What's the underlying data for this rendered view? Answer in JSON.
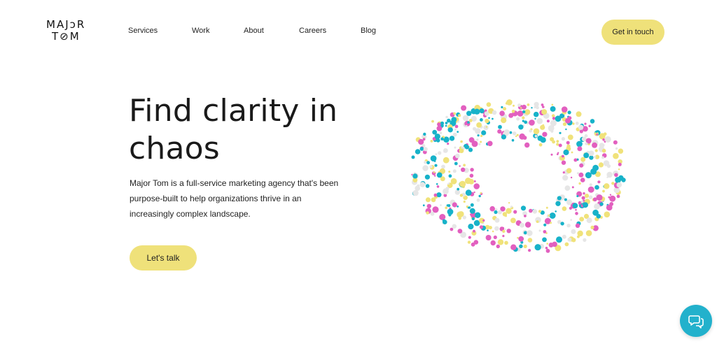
{
  "brand": {
    "line1": "MAJɔR",
    "line2": "T⊘M"
  },
  "nav": {
    "items": [
      {
        "label": "Services"
      },
      {
        "label": "Work"
      },
      {
        "label": "About"
      },
      {
        "label": "Careers"
      },
      {
        "label": "Blog"
      }
    ],
    "cta_label": "Get in touch"
  },
  "hero": {
    "title": "Find clarity in chaos",
    "description": "Major Tom is a full-service marketing agency that's been purpose-built to help organizations thrive in an increasingly complex landscape.",
    "cta_label": "Let's talk"
  },
  "art": {
    "colors": [
      "#e25fbf",
      "#17b2c9",
      "#f0e27a",
      "#e6e6e6"
    ]
  },
  "chat": {
    "icon": "chat-bubbles-icon"
  },
  "theme": {
    "accent": "#efe17a",
    "chat_bg": "#22b1cc",
    "text": "#1a1a1a"
  }
}
